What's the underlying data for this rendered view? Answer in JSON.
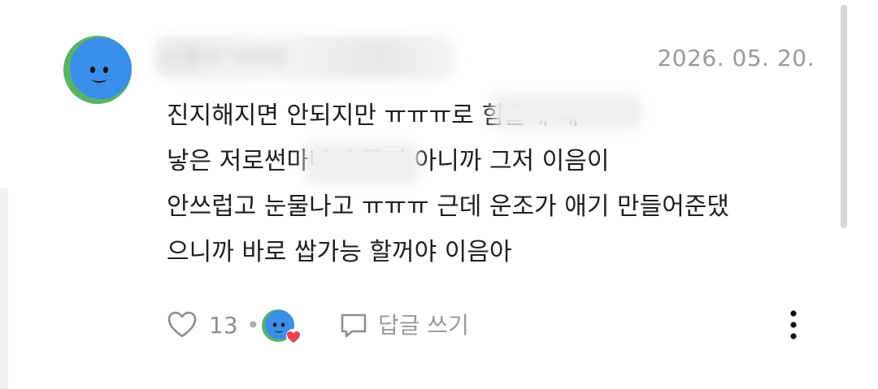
{
  "comment": {
    "username": "사용자 닉네임",
    "date": "2026. 05. 20.",
    "lines": [
      "진지해지면 안되지만 ㅠㅠㅠ로 힘들게 애",
      "낳은 저로썬마나 슬픈지 아니까 그저 이음이",
      "안쓰럽고 눈물나고 ㅠㅠㅠ 근데 운조가 애기 만들어준댔",
      "으니까 바로 쌉가능 할꺼야 이음아"
    ],
    "like_count": "13",
    "separator": "•",
    "reply_label": "답글 쓰기"
  },
  "icons": {
    "avatar": "smiley-avatar-icon",
    "like": "heart-outline-icon",
    "reactor": "reactor-avatar-heart-icon",
    "reply": "speech-bubble-icon",
    "more": "more-vertical-icon"
  },
  "colors": {
    "avatar_blue": "#3b8fe8",
    "avatar_green": "#58b368",
    "heart_red": "#e8434f",
    "muted_text": "#9a9a9a"
  }
}
